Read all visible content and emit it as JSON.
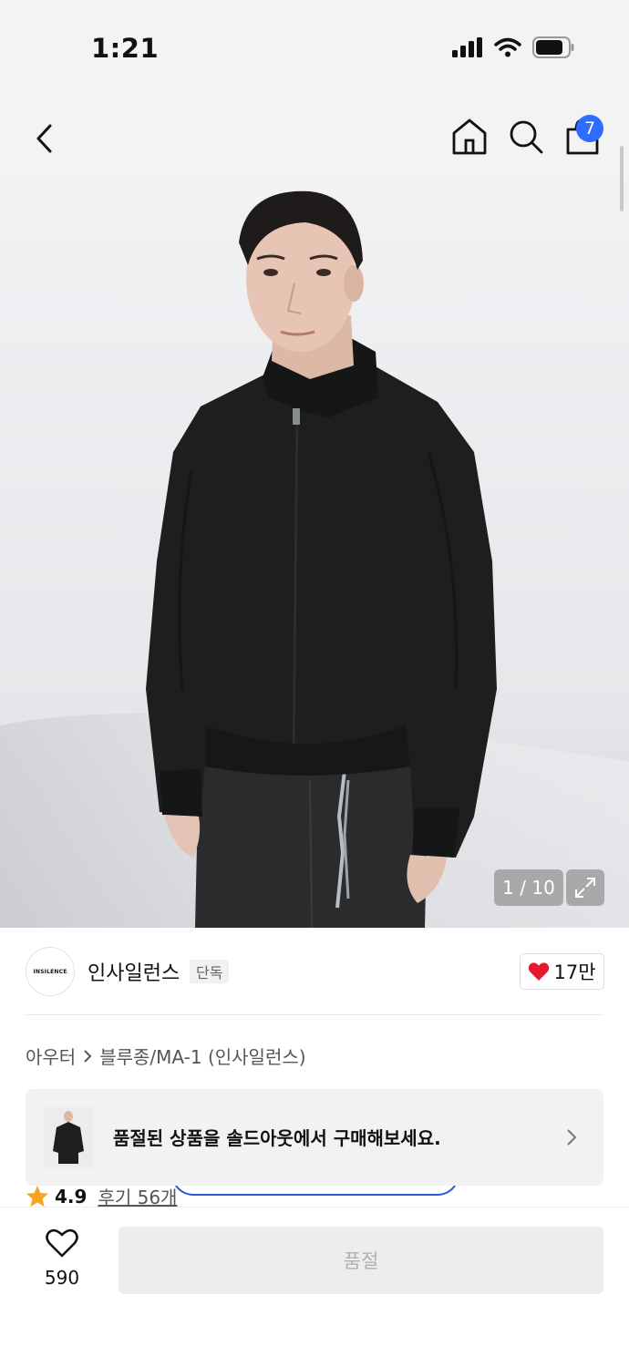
{
  "status_bar": {
    "time": "1:21"
  },
  "nav": {
    "cart_count": "7"
  },
  "hero": {
    "counter": "1 / 10"
  },
  "brand": {
    "logo_text": "INSILENCE",
    "name": "인사일런스",
    "badge": "단독",
    "likes": "17만"
  },
  "breadcrumb": {
    "items": [
      "아우터",
      "블루종/MA-1 (인사일런스)"
    ]
  },
  "rating": {
    "score": "4.9",
    "reviews": "후기 56개"
  },
  "soldout_banner": {
    "text": "품절된 상품을 솔드아웃에서 구매해보세요."
  },
  "bottom_bar": {
    "wish_count": "590",
    "soldout_label": "품절"
  },
  "colors": {
    "accent": "#2f6bff",
    "heart": "#e8192c",
    "star": "#f6a523"
  }
}
